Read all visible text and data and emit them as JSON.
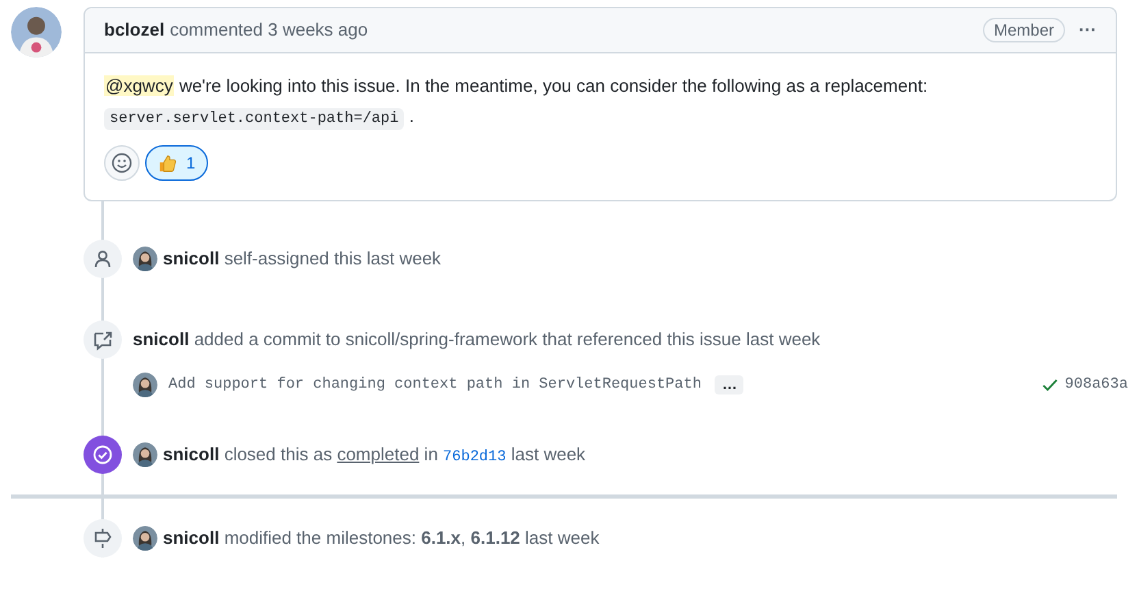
{
  "comment": {
    "author": "bclozel",
    "action": "commented 3 weeks ago",
    "role": "Member",
    "menu": "···",
    "body": {
      "mention": "@xgwcy",
      "text": "we're looking into this issue. In the meantime, you can consider the following as a replacement:",
      "code": "server.servlet.context-path=/api",
      "end": "."
    },
    "reactions": [
      {
        "kind": "thumbs-up",
        "count": "1",
        "selected": true
      }
    ]
  },
  "events": [
    {
      "kind": "assigned",
      "actor": "snicoll",
      "text": "self-assigned this last week"
    },
    {
      "kind": "referenced",
      "actor": "snicoll",
      "text": "added a commit to snicoll/spring-framework that referenced this issue last week",
      "commit": {
        "message": "Add support for changing context path in ServletRequestPath",
        "more": "…",
        "sha": "908a63a"
      }
    },
    {
      "kind": "closed",
      "actor": "snicoll",
      "text": "closed this as",
      "link": "completed",
      "in": "in",
      "sha": "76b2d13",
      "when": "last week"
    },
    {
      "kind": "milestone",
      "actor": "snicoll",
      "text": "modified the milestones: **6.1.x**, **6.1.12** last week"
    }
  ]
}
